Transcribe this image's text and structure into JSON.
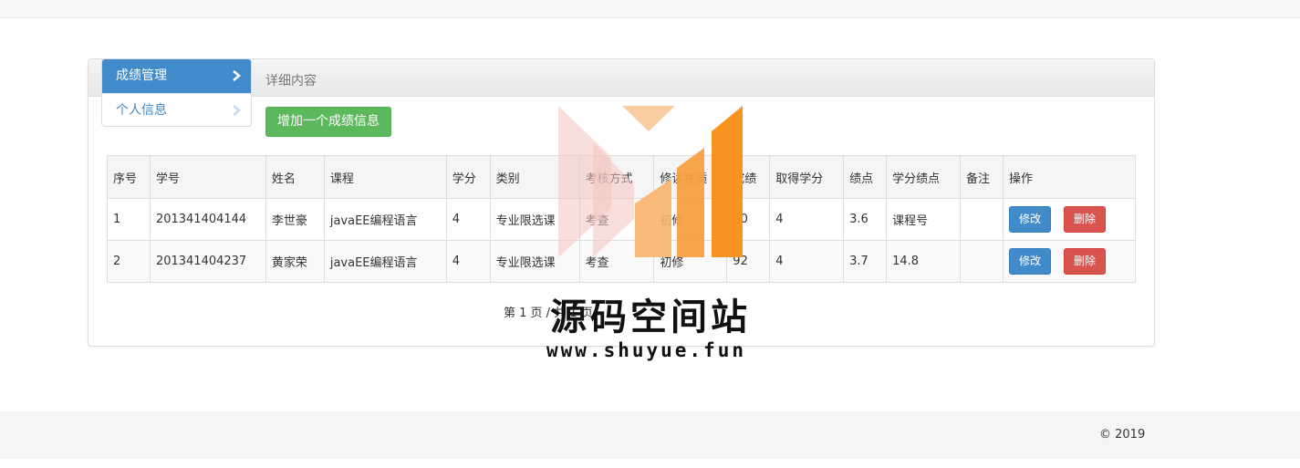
{
  "sidebar": {
    "items": [
      {
        "label": "成绩管理",
        "active": true
      },
      {
        "label": "个人信息",
        "active": false
      }
    ]
  },
  "panel": {
    "heading": "详细内容",
    "add_button": "增加一个成绩信息"
  },
  "table": {
    "headers": [
      "序号",
      "学号",
      "姓名",
      "课程",
      "学分",
      "类别",
      "考核方式",
      "修读性质",
      "成绩",
      "取得学分",
      "绩点",
      "学分绩点",
      "备注",
      "操作"
    ],
    "rows": [
      {
        "no": "1",
        "student_id": "201341404144",
        "name": "李世豪",
        "course": "javaEE编程语言",
        "credit": "4",
        "category": "专业限选课",
        "exam": "考查",
        "nature": "初修",
        "score": "90",
        "earned": "4",
        "gpa": "3.6",
        "credit_gpa": "课程号",
        "remark": ""
      },
      {
        "no": "2",
        "student_id": "201341404237",
        "name": "黄家荣",
        "course": "javaEE编程语言",
        "credit": "4",
        "category": "专业限选课",
        "exam": "考查",
        "nature": "初修",
        "score": "92",
        "earned": "4",
        "gpa": "3.7",
        "credit_gpa": "14.8",
        "remark": ""
      }
    ],
    "edit_label": "修改",
    "delete_label": "删除"
  },
  "pager": {
    "text": "第 1 页 / 共 1 页"
  },
  "watermark": {
    "title": "源码空间站",
    "url": "www.shuyue.fun"
  },
  "footer": {
    "copyright": "© 2019"
  },
  "colors": {
    "primary": "#428bca",
    "success": "#5cb85c",
    "danger": "#d9534f",
    "watermark_orange": "#f7931e"
  }
}
